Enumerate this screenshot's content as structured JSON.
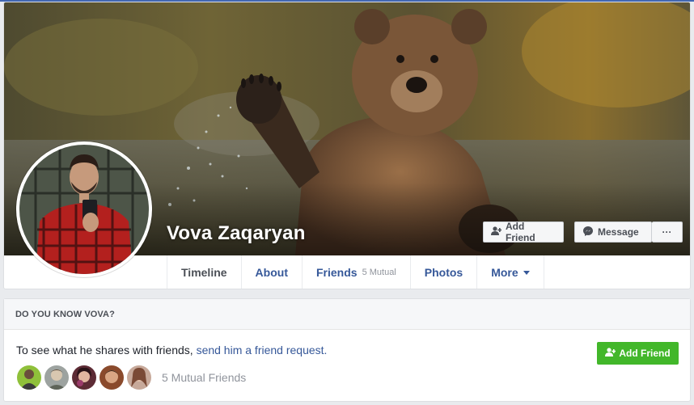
{
  "profile": {
    "name": "Vova Zaqaryan"
  },
  "actions": {
    "add_friend": "Add Friend",
    "message": "Message",
    "more": "···"
  },
  "tabs": [
    {
      "label": "Timeline"
    },
    {
      "label": "About"
    },
    {
      "label": "Friends",
      "sub": "5 Mutual"
    },
    {
      "label": "Photos"
    },
    {
      "label": "More"
    }
  ],
  "know": {
    "header": "DO YOU KNOW VOVA?",
    "text": "To see what he shares with friends, ",
    "link": "send him a friend request.",
    "button": "Add Friend",
    "mutual": "5 Mutual Friends"
  },
  "colors": {
    "brand": "#4267b2",
    "link": "#365899",
    "green": "#42b72a"
  }
}
